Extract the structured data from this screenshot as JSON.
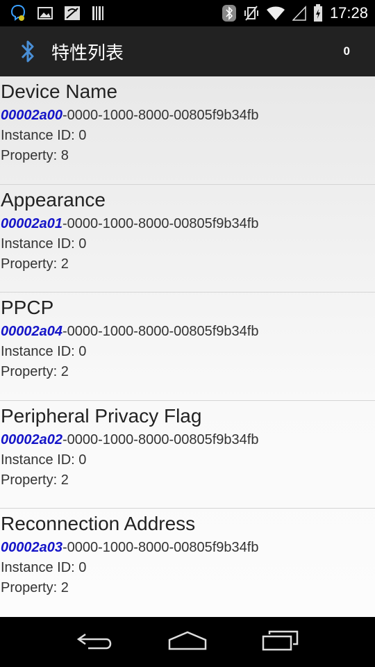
{
  "status_bar": {
    "time": "17:28",
    "left_icons": [
      "bluetooth-chat-notification-icon",
      "image-notification-icon",
      "no-signal-notification-icon",
      "barcode-notification-icon"
    ],
    "right_icons": [
      "bluetooth-icon",
      "vibrate-icon",
      "wifi-icon",
      "cell-signal-icon",
      "battery-icon"
    ]
  },
  "action_bar": {
    "icon": "bluetooth-icon",
    "title": "特性列表",
    "count": "0"
  },
  "characteristics": [
    {
      "name": "Device Name",
      "uuid_short": "00002a00",
      "uuid_rest": "-0000-1000-8000-00805f9b34fb",
      "instance": "Instance ID: 0",
      "property": "Property: 8"
    },
    {
      "name": "Appearance",
      "uuid_short": "00002a01",
      "uuid_rest": "-0000-1000-8000-00805f9b34fb",
      "instance": "Instance ID: 0",
      "property": "Property: 2"
    },
    {
      "name": "PPCP",
      "uuid_short": "00002a04",
      "uuid_rest": "-0000-1000-8000-00805f9b34fb",
      "instance": "Instance ID: 0",
      "property": "Property: 2"
    },
    {
      "name": "Peripheral Privacy Flag",
      "uuid_short": "00002a02",
      "uuid_rest": "-0000-1000-8000-00805f9b34fb",
      "instance": "Instance ID: 0",
      "property": "Property: 2"
    },
    {
      "name": "Reconnection Address",
      "uuid_short": "00002a03",
      "uuid_rest": "-0000-1000-8000-00805f9b34fb",
      "instance": "Instance ID: 0",
      "property": "Property: 2"
    }
  ],
  "nav_bar": {
    "buttons": [
      "back-icon",
      "home-icon",
      "recents-icon"
    ]
  },
  "colors": {
    "uuid_accent": "#1515c8",
    "action_bar_bg": "#222222",
    "status_bar_bg": "#000000"
  }
}
